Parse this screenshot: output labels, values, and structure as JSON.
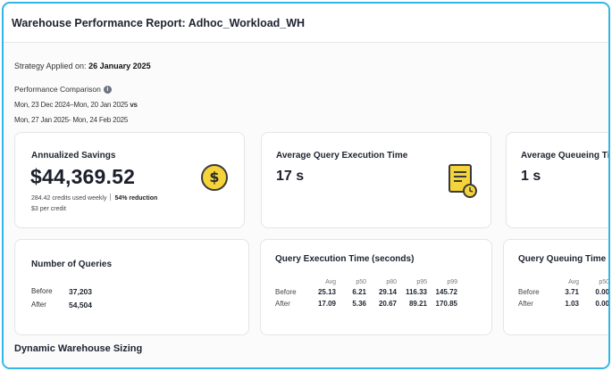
{
  "header": {
    "title": "Warehouse Performance Report: Adhoc_Workload_WH"
  },
  "strategy": {
    "label": "Strategy Applied on:",
    "date": "26 January 2025"
  },
  "performance": {
    "title": "Performance Comparison",
    "info_icon": "info-icon",
    "range1": "Mon, 23 Dec 2024–Mon, 20 Jan 2025",
    "vs": "vs",
    "range2": "Mon, 27 Jan 2025- Mon, 24 Feb 2025"
  },
  "cards": {
    "savings": {
      "title": "Annualized Savings",
      "value": "$44,369.52",
      "credits": "284.42 credits used weekly",
      "reduction": "54% reduction",
      "price": "$3 per credit",
      "icon": "dollar-icon",
      "icon_color": "#f5d33a"
    },
    "exec_time": {
      "title": "Average Query Execution Time",
      "value": "17 s",
      "icon": "report-clock-icon"
    },
    "queue_time": {
      "title": "Average Queueing Ti",
      "value": "1 s"
    },
    "queries": {
      "title": "Number of Queries",
      "before_label": "Before",
      "before_value": "37,203",
      "after_label": "After",
      "after_value": "54,504"
    },
    "exec_table": {
      "title": "Query Execution Time (seconds)",
      "columns": [
        "Avg",
        "p50",
        "p80",
        "p95",
        "p99"
      ],
      "rows": [
        {
          "label": "Before",
          "values": [
            "25.13",
            "6.21",
            "29.14",
            "116.33",
            "145.72"
          ]
        },
        {
          "label": "After",
          "values": [
            "17.09",
            "5.36",
            "20.67",
            "89.21",
            "170.85"
          ]
        }
      ]
    },
    "queue_table": {
      "title": "Query Queuing Time (",
      "columns": [
        "Avg",
        "p50"
      ],
      "rows": [
        {
          "label": "Before",
          "values": [
            "3.71",
            "0.00"
          ]
        },
        {
          "label": "After",
          "values": [
            "1.03",
            "0.00"
          ]
        }
      ]
    }
  },
  "section": {
    "title": "Dynamic Warehouse Sizing"
  },
  "colors": {
    "frame_border": "#33b5e5",
    "icon_yellow": "#f5d33a"
  }
}
